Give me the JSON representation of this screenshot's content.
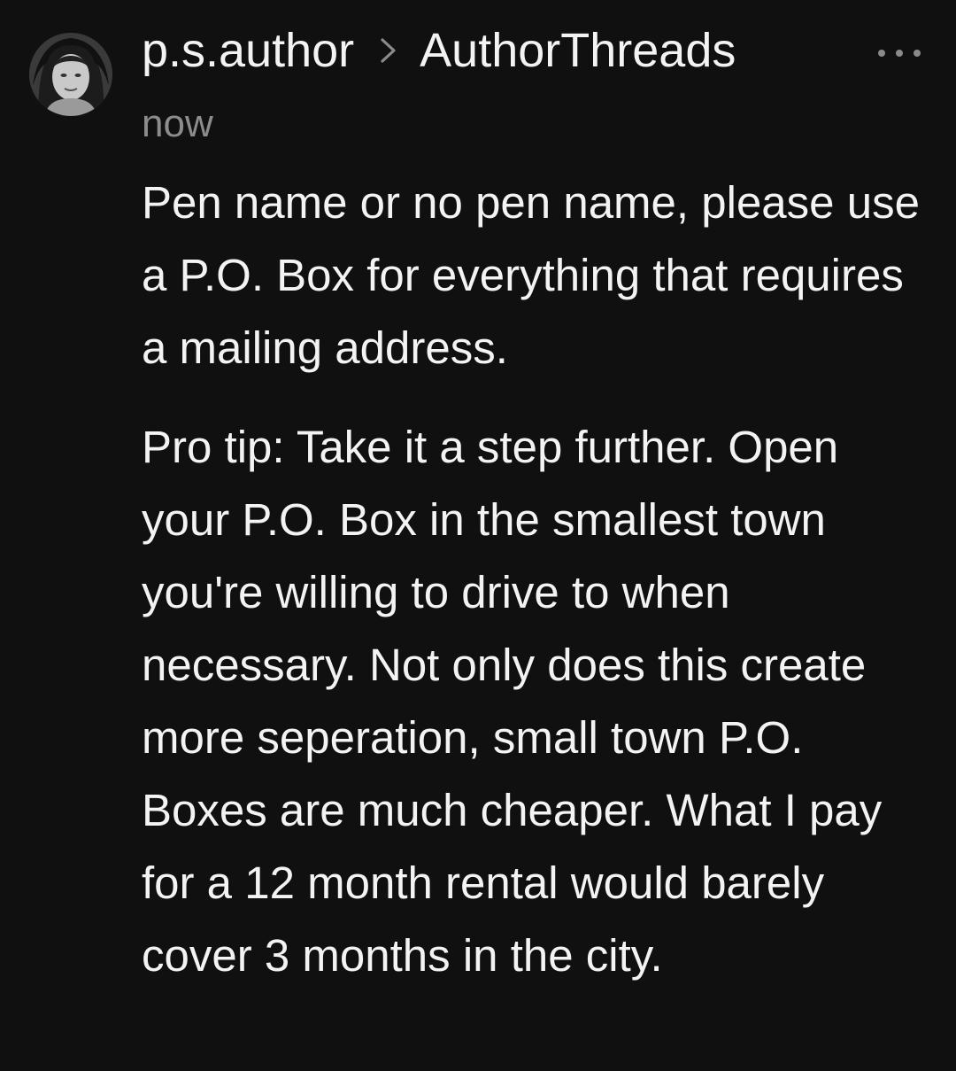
{
  "post": {
    "author": "p.s.author",
    "community": "AuthorThreads",
    "timestamp": "now",
    "paragraphs": [
      "Pen name or no pen name, please use a P.O. Box for everything that requires a mailing address.",
      "Pro tip: Take it a step further. Open your P.O. Box in the smallest town you're willing to drive to when necessary. Not only does this create more seperation, small town P.O. Boxes are much cheaper. What I pay for a 12 month rental would barely cover 3 months in the city."
    ]
  },
  "icons": {
    "avatar": "user-avatar",
    "separator": "chevron-right-icon",
    "menu": "more-horizontal-icon"
  },
  "colors": {
    "background": "#101010",
    "text": "#f3f3f3",
    "muted": "#8c8c8c"
  }
}
